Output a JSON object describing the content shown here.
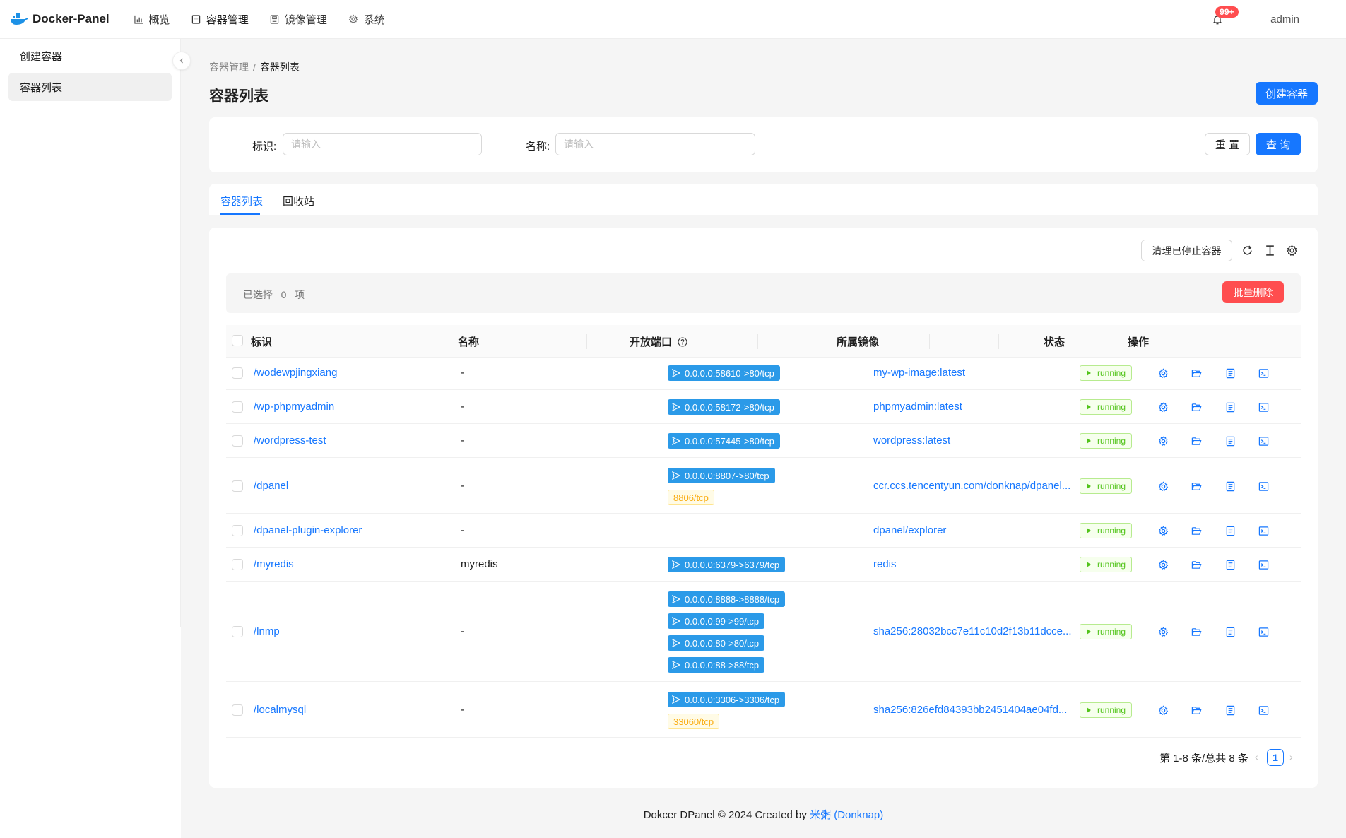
{
  "app": {
    "brand": "Docker-Panel",
    "nav": [
      {
        "label": "概览",
        "icon": "chart-icon"
      },
      {
        "label": "容器管理",
        "icon": "container-icon"
      },
      {
        "label": "镜像管理",
        "icon": "image-icon"
      },
      {
        "label": "系统",
        "icon": "gear-icon"
      }
    ],
    "notification_count": "99+",
    "user": "admin"
  },
  "sidebar": {
    "items": [
      {
        "label": "创建容器"
      },
      {
        "label": "容器列表"
      }
    ]
  },
  "breadcrumb": {
    "parent": "容器管理",
    "separator": "/",
    "current": "容器列表"
  },
  "page": {
    "title": "容器列表",
    "create_button": "创建容器"
  },
  "search": {
    "id_label": "标识:",
    "id_placeholder": "请输入",
    "name_label": "名称:",
    "name_placeholder": "请输入",
    "reset_button": "重 置",
    "query_button": "查 询"
  },
  "tabs": [
    {
      "label": "容器列表",
      "active": true
    },
    {
      "label": "回收站",
      "active": false
    }
  ],
  "toolbar": {
    "clean_button": "清理已停止容器"
  },
  "selection": {
    "prefix": "已选择",
    "count": "0",
    "suffix": "项",
    "batch_delete": "批量删除"
  },
  "table": {
    "columns": [
      "标识",
      "名称",
      "开放端口",
      "所属镜像",
      "状态",
      "操作"
    ],
    "rows": [
      {
        "id": "/wodewpjingxiang",
        "name": "-",
        "ports": [
          "0.0.0.0:58610->80/tcp"
        ],
        "exposed": [],
        "image": "my-wp-image:latest",
        "status": "running"
      },
      {
        "id": "/wp-phpmyadmin",
        "name": "-",
        "ports": [
          "0.0.0.0:58172->80/tcp"
        ],
        "exposed": [],
        "image": "phpmyadmin:latest",
        "status": "running"
      },
      {
        "id": "/wordpress-test",
        "name": "-",
        "ports": [
          "0.0.0.0:57445->80/tcp"
        ],
        "exposed": [],
        "image": "wordpress:latest",
        "status": "running"
      },
      {
        "id": "/dpanel",
        "name": "-",
        "ports": [
          "0.0.0.0:8807->80/tcp"
        ],
        "exposed": [
          "8806/tcp"
        ],
        "image": "ccr.ccs.tencentyun.com/donknap/dpanel...",
        "status": "running"
      },
      {
        "id": "/dpanel-plugin-explorer",
        "name": "-",
        "ports": [],
        "exposed": [],
        "image": "dpanel/explorer",
        "status": "running"
      },
      {
        "id": "/myredis",
        "name": "myredis",
        "ports": [
          "0.0.0.0:6379->6379/tcp"
        ],
        "exposed": [],
        "image": "redis",
        "status": "running"
      },
      {
        "id": "/lnmp",
        "name": "-",
        "ports": [
          "0.0.0.0:8888->8888/tcp",
          "0.0.0.0:99->99/tcp",
          "0.0.0.0:80->80/tcp",
          "0.0.0.0:88->88/tcp"
        ],
        "exposed": [],
        "image": "sha256:28032bcc7e11c10d2f13b11dcce...",
        "status": "running"
      },
      {
        "id": "/localmysql",
        "name": "-",
        "ports": [
          "0.0.0.0:3306->3306/tcp"
        ],
        "exposed": [
          "33060/tcp"
        ],
        "image": "sha256:826efd84393bb2451404ae04fd...",
        "status": "running"
      }
    ]
  },
  "pagination": {
    "summary": "第 1-8 条/总共 8 条",
    "current_page": "1"
  },
  "footer": {
    "text": "Dokcer DPanel © 2024 Created by ",
    "author": "米粥 (Donknap)"
  },
  "colors": {
    "primary": "#1677ff",
    "danger": "#ff4d4f",
    "success": "#52c41a",
    "port_tag": "#2b9ae8",
    "warning": "#faad14"
  }
}
